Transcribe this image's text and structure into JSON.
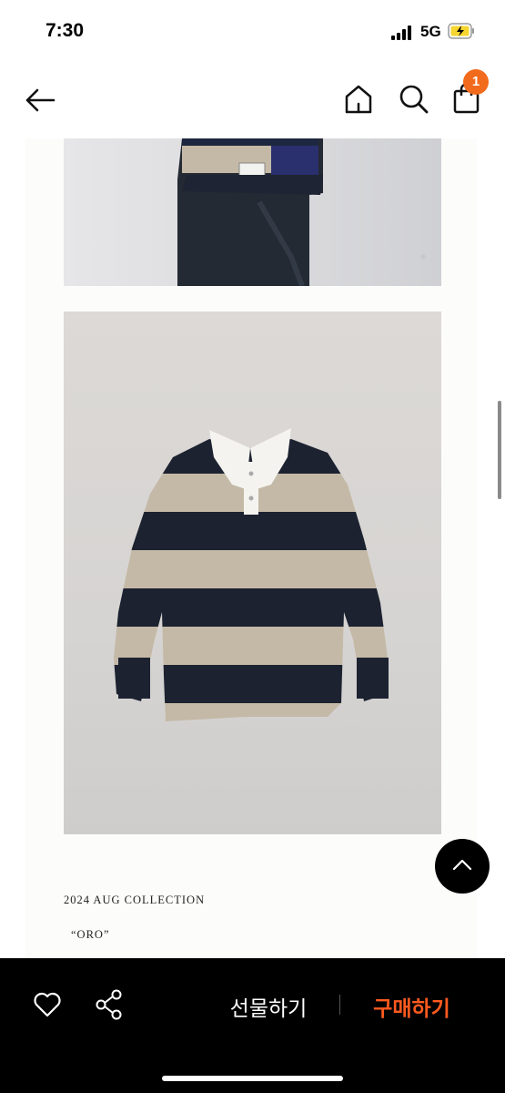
{
  "status_bar": {
    "time": "7:30",
    "network": "5G"
  },
  "nav": {
    "cart_count": "1",
    "icons": [
      "back-arrow-icon",
      "home-icon",
      "search-icon",
      "cart-icon"
    ]
  },
  "content": {
    "collection_label": "2024 AUG COLLECTION",
    "product_code": "“ORO”"
  },
  "action_bar": {
    "gift_label": "선물하기",
    "buy_label": "구매하기",
    "icons": [
      "heart-icon",
      "share-icon"
    ]
  },
  "colors": {
    "accent": "#ff5a1f",
    "action_bar_bg": "#000000",
    "badge_bg": "#f26a1b",
    "stripe_navy": "#1c2230",
    "stripe_beige": "#c4b9a6"
  }
}
